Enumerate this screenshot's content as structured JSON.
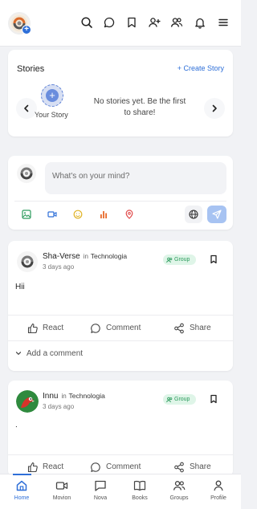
{
  "stories": {
    "title": "Stories",
    "create_label": "+ Create Story",
    "your_story_label": "Your Story",
    "empty_text": "No stories yet. Be the first to share!"
  },
  "composer": {
    "placeholder": "What's on your mind?"
  },
  "posts": [
    {
      "author": "Sha-Verse",
      "in_label": "in",
      "group": "Technologia",
      "time": "3 days ago",
      "badge": "Group",
      "body": "Hii",
      "react_label": "React",
      "comment_label": "Comment",
      "share_label": "Share",
      "add_comment_label": "Add a comment"
    },
    {
      "author": "Innu",
      "in_label": "in",
      "group": "Technologia",
      "time": "3 days ago",
      "badge": "Group",
      "body": ".",
      "react_label": "React",
      "comment_label": "Comment",
      "share_label": "Share"
    }
  ],
  "bottom_nav": [
    {
      "label": "Home",
      "icon": "home-icon",
      "active": true
    },
    {
      "label": "Movion",
      "icon": "video-icon"
    },
    {
      "label": "Nova",
      "icon": "chat-icon"
    },
    {
      "label": "Books",
      "icon": "book-icon"
    },
    {
      "label": "Groups",
      "icon": "users-icon"
    },
    {
      "label": "Profile",
      "icon": "user-icon"
    }
  ],
  "colors": {
    "accent": "#2e6fd8",
    "group_badge_bg": "#dff5e8",
    "group_badge_text": "#2c9b5d",
    "send_button": "#a7c3f2"
  }
}
